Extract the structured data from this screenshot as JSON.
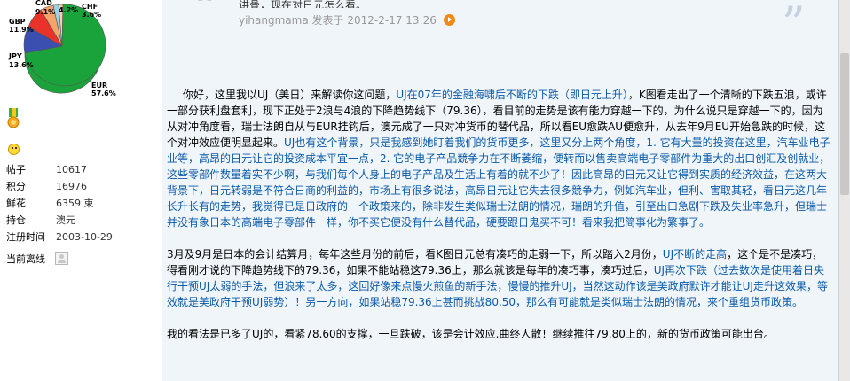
{
  "user": {
    "pie_labels": [
      {
        "name": "CAD",
        "value": "9.1%"
      },
      {
        "name": "CAD",
        "value": "4.2%"
      },
      {
        "name": "CHF",
        "value": "3.6%"
      },
      {
        "name": "GBP",
        "value": "11.9%"
      },
      {
        "name": "JPY",
        "value": "13.6%"
      },
      {
        "name": "EUR",
        "value": "57.6%"
      }
    ],
    "pie_colors": {
      "EUR": "#1aa33a",
      "JPY": "#3a4fb0",
      "GBP": "#e8322a",
      "CAD1": "#f5a46b",
      "CAD2": "#9ed1e8",
      "CHF": "#f2d2a8"
    },
    "stats": [
      {
        "label": "帖子",
        "value": "10617"
      },
      {
        "label": "积分",
        "value": "16976"
      },
      {
        "label": "鲜花",
        "value": "6359 束"
      },
      {
        "label": "持仓",
        "value": "澳元"
      },
      {
        "label": "注册时间",
        "value": "2003-10-29"
      }
    ],
    "status_label": "当前离线",
    "medal_icon": "medal-icon",
    "smiley_icon": "smiley-icon"
  },
  "quote": {
    "text": "讲骨，现在对日元怎么看。",
    "author": "yihangmama",
    "posted_label": "发表于",
    "date": "2012-2-17 13:26"
  },
  "post": {
    "p1_a": "你好，这里我以UJ（美日）来解读你这问题，",
    "p1_b": "UJ在07年的金融海啸后不断的下跌（即日元上升）",
    "p1_c": "，K图看走出了一个清晰的下跌五浪，或许一部分获利盘套利，现下正处于2浪与4浪的下降趋势线下（79.36），看目前的走势是该有能力穿越一下的，为什么说只是穿越一下的，因为从对冲角度看，瑞士法朗自从与EUR挂钩后，澳元成了一只对冲货币的替代品，所以看EU愈跌AU便愈升，从去年9月EU开始急跌的时候，这个对冲效应便明显起来。",
    "p1_d": "UJ也有这个背景，只是我感到她盯着我们的货币更多，这里又分上两个角度，1. 它有大量的投资在这里，汽车业电子业等，高昂的日元让它的投资成本平宜一点，2. 它的电子产品競争力在不断萎缩，便转而以售卖高端电子零部件为重大的出口创汇及创就业，这些零部件数量着实不少啊，与我们每个人身上的电子产品及生活上有着的就不少了！因此高昂的日元又让它得到实质的经济效益，在这两大背景下，日元转弱是不符合日商的利益的，市场上有很多说法，高昂日元让它失去很多競争力，例如汽车业，但利、害取其轻，看日元这几年长升长有的走势，我觉得已是日政府的一个政策来的，除非发生类似瑞士法朗的情况，瑞朗的升值，引至出口急剧下跌及失业率急升，但瑞士并没有象日本的高端电子零部件一样，你不买它便没有什么替代品，硬要跟日鬼买不可！看来我把简事化为繁事了。",
    "p2_a": "3月及9月是日本的会计结算月，每年这些月份的前后，看K图日元总有凑巧的走弱一下，所以踏入2月份，",
    "p2_b": "UJ不断的走高",
    "p2_c": "，这个是不是凑巧，得看刚才说的下降趋势线下的79.36，如果不能站稳这79.36上，那么就该是每年的凑巧事，凑巧过后，",
    "p2_d": "UJ再次下跌（过去数次是使用着日央行干预UJ太弱的手法，但浪来了太多，这回好像来点慢火煎鱼的新手法，慢慢的推升UJ，当然这动作该是美政府默许才能让UJ走升这效果，等效就是美政府干预UJ弱势）！另一方向，如果站稳79.36上甚而挑战80.50，那么有可能就是类似瑞士法朗的情况，来个重组货币政策。",
    "p3": "我的看法是已多了UJ的，看紧78.60的支撑，一旦跌破，该是会计效应.曲终人散！继续推往79.80上的，新的货币政策可能出台。"
  }
}
